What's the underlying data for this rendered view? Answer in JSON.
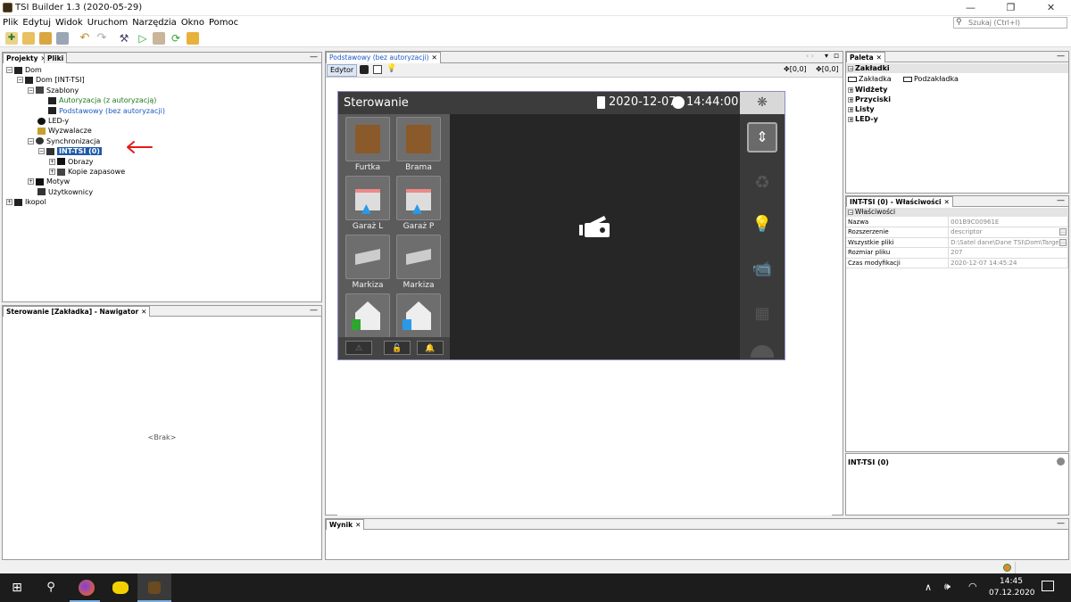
{
  "window": {
    "title": "TSI Builder 1.3 (2020-05-29)",
    "minimize": "—",
    "maximize": "❐",
    "close": "✕"
  },
  "menu": [
    "Plik",
    "Edytuj",
    "Widok",
    "Uruchom",
    "Narzędzia",
    "Okno",
    "Pomoc"
  ],
  "search": {
    "placeholder": "Szukaj (Ctrl+I)"
  },
  "projects_panel": {
    "tabs": [
      "Projekty",
      "Pliki"
    ],
    "tree": [
      {
        "label": "Dom",
        "level": 0,
        "expander": "−",
        "icon": "device-icon"
      },
      {
        "label": "Dom [INT-TSI]",
        "level": 1,
        "expander": "−",
        "icon": "plug-icon"
      },
      {
        "label": "Szablony",
        "level": 2,
        "expander": "−",
        "icon": "templates-icon"
      },
      {
        "label": "Autoryzacja (z autoryzacją)",
        "level": 3,
        "expander": "",
        "icon": "screen-icon",
        "color": "green"
      },
      {
        "label": "Podstawowy (bez autoryzacji)",
        "level": 3,
        "expander": "",
        "icon": "screen-icon",
        "color": "blue"
      },
      {
        "label": "LED-y",
        "level": 2,
        "expander": "",
        "icon": "led-icon"
      },
      {
        "label": "Wyzwalacze",
        "level": 2,
        "expander": "",
        "icon": "trigger-icon"
      },
      {
        "label": "Synchronizacja",
        "level": 2,
        "expander": "−",
        "icon": "sync-icon"
      },
      {
        "label": "INT-TSI     (0)",
        "level": 3,
        "expander": "−",
        "icon": "network-icon",
        "selected": true
      },
      {
        "label": "Obrazy",
        "level": 4,
        "expander": "+",
        "icon": "folder-icon"
      },
      {
        "label": "Kopie zapasowe",
        "level": 4,
        "expander": "+",
        "icon": "backup-icon"
      },
      {
        "label": "Motyw",
        "level": 2,
        "expander": "+",
        "icon": "folder-icon"
      },
      {
        "label": "Użytkownicy",
        "level": 2,
        "expander": "",
        "icon": "users-icon"
      },
      {
        "label": "Ikopol",
        "level": 0,
        "expander": "+",
        "icon": "device-icon"
      }
    ]
  },
  "navigator_panel": {
    "tab": "Sterowanie [Zakładka] - Nawigator",
    "empty": "<Brak>"
  },
  "editor": {
    "tab": "Podstawowy (bez autoryzacji)",
    "subtab": "Edytor",
    "coords1": "[0,0]",
    "coords2": "[0,0]",
    "device": {
      "title": "Sterowanie",
      "date": "2020-12-07",
      "time": "14:44:00",
      "tiles": [
        {
          "label": "Furtka",
          "icon": "gate-door-icon"
        },
        {
          "label": "Brama",
          "icon": "gate-icon"
        },
        {
          "label": "Garaż L",
          "icon": "garage-left-icon"
        },
        {
          "label": "Garaż P",
          "icon": "garage-right-icon"
        },
        {
          "label": "Markiza",
          "icon": "awning-icon"
        },
        {
          "label": "Markiza",
          "icon": "awning-icon"
        },
        {
          "label": "",
          "icon": "house-disarmed-icon"
        },
        {
          "label": "",
          "icon": "house-armed-icon"
        }
      ],
      "bottom_buttons": [
        "warning-icon",
        "unlock-icon",
        "bell-icon"
      ],
      "right_icons": [
        "fan-icon",
        "updown-icon",
        "recycle-icon",
        "bulb-icon",
        "camera-icon",
        "calculator-icon",
        "round-icon"
      ]
    }
  },
  "palette": {
    "tab": "Paleta",
    "sections": [
      {
        "label": "Zakładki",
        "expander": "−",
        "items": [
          "Zakładka",
          "Podzakładka"
        ]
      },
      {
        "label": "Widżety",
        "expander": "+"
      },
      {
        "label": "Przyciski",
        "expander": "+"
      },
      {
        "label": "Listy",
        "expander": "+"
      },
      {
        "label": "LED-y",
        "expander": "+"
      }
    ]
  },
  "properties": {
    "tab": "INT-TSI     (0) - Właściwości",
    "section": "Właściwości",
    "rows": [
      {
        "key": "Nazwa",
        "value": "001B9C00961E"
      },
      {
        "key": "Rozszerzenie",
        "value": "descriptor"
      },
      {
        "key": "Wszystkie pliki",
        "value": "D:\\Satel dane\\Dane TSI\\Dom\\Target..."
      },
      {
        "key": "Rozmiar pliku",
        "value": "207"
      },
      {
        "key": "Czas modyfikacji",
        "value": "2020-12-07 14:45:24"
      }
    ],
    "footer": "INT-TSI     (0)"
  },
  "output": {
    "tab": "Wynik"
  },
  "taskbar": {
    "time": "14:45",
    "date": "07.12.2020"
  }
}
